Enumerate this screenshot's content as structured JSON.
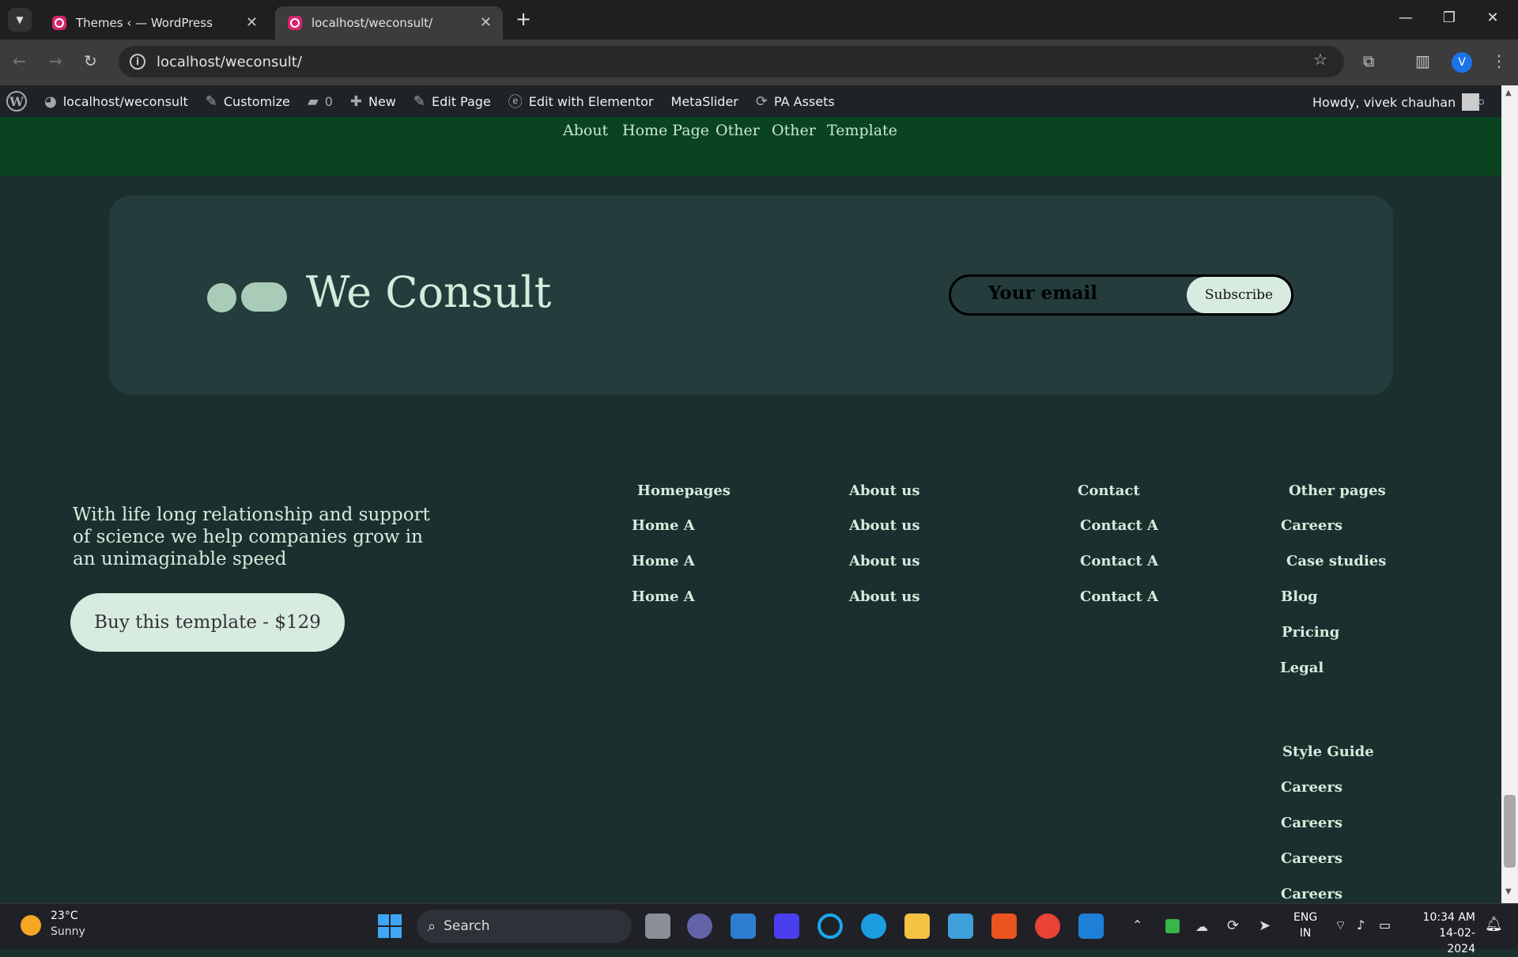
{
  "browser": {
    "tabs": [
      {
        "title": "Themes ‹ — WordPress"
      },
      {
        "title": "localhost/weconsult/"
      }
    ],
    "url": "localhost/weconsult/",
    "profile_initial": "V"
  },
  "adminbar": {
    "site": "localhost/weconsult",
    "customize": "Customize",
    "comments_count": "0",
    "new": "New",
    "edit_page": "Edit Page",
    "edit_elementor": "Edit with Elementor",
    "metaslider": "MetaSlider",
    "pa_assets": "PA Assets",
    "howdy": "Howdy, vivek chauhan"
  },
  "nav": [
    "About",
    "Home Page",
    "Other",
    "Other",
    "Template"
  ],
  "card": {
    "brand": "We Consult",
    "email_placeholder": "Your email",
    "subscribe": "Subscribe"
  },
  "footer": {
    "tagline": "With life long relationship and support of science we help companies grow in an unimaginable speed",
    "buy_button": "Buy this template - $129",
    "columns": [
      {
        "heading": "Homepages",
        "links": [
          "Home A",
          "Home A",
          "Home A"
        ]
      },
      {
        "heading": "About us",
        "links": [
          "About us",
          "About us",
          "About us"
        ]
      },
      {
        "heading": "Contact",
        "links": [
          "Contact A",
          "Contact A",
          "Contact A"
        ]
      },
      {
        "heading": "Other pages",
        "links": [
          "Careers",
          "Case studies",
          "Blog",
          "Pricing",
          "Legal"
        ]
      }
    ],
    "style_guide": {
      "heading": "Style Guide",
      "links": [
        "Careers",
        "Careers",
        "Careers",
        "Careers"
      ]
    }
  },
  "taskbar": {
    "temp": "23°C",
    "weather": "Sunny",
    "search": "Search",
    "lang1": "ENG",
    "lang2": "IN",
    "time": "10:34 AM",
    "date": "14-02-2024"
  }
}
